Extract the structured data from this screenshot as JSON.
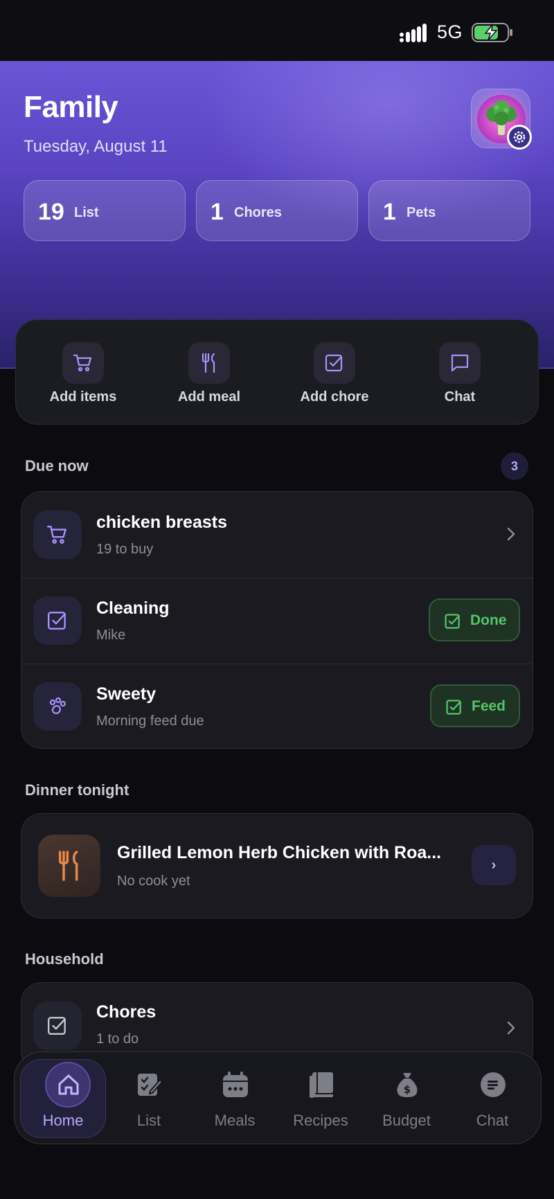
{
  "status_bar": {
    "network": "5G"
  },
  "header": {
    "title": "Family",
    "date": "Tuesday, August 11"
  },
  "stats": [
    {
      "value": "19",
      "label": "List"
    },
    {
      "value": "1",
      "label": "Chores"
    },
    {
      "value": "1",
      "label": "Pets"
    }
  ],
  "quick_actions": [
    {
      "label": "Add items",
      "icon": "cart-icon"
    },
    {
      "label": "Add meal",
      "icon": "fork-knife-icon"
    },
    {
      "label": "Add chore",
      "icon": "checkbox-icon"
    },
    {
      "label": "Chat",
      "icon": "chat-bubble-icon"
    }
  ],
  "due_now": {
    "title": "Due now",
    "count": "3",
    "items": [
      {
        "title": "chicken breasts",
        "subtitle": "19 to buy",
        "icon": "cart-icon"
      },
      {
        "title": "Cleaning",
        "subtitle": "Mike",
        "icon": "checkbox-icon",
        "action": "Done"
      },
      {
        "title": "Sweety",
        "subtitle": "Morning feed due",
        "icon": "paw-icon",
        "action": "Feed"
      }
    ]
  },
  "dinner": {
    "title": "Dinner tonight",
    "meal_title": "Grilled Lemon Herb Chicken with Roa...",
    "meal_subtitle": "No cook yet",
    "go_label": "›"
  },
  "household": {
    "title": "Household",
    "chores_title": "Chores",
    "chores_subtitle": "1 to do"
  },
  "tabs": [
    {
      "label": "Home",
      "icon": "home-icon",
      "active": true
    },
    {
      "label": "List",
      "icon": "list-icon"
    },
    {
      "label": "Meals",
      "icon": "calendar-icon"
    },
    {
      "label": "Recipes",
      "icon": "book-icon"
    },
    {
      "label": "Budget",
      "icon": "money-bag-icon"
    },
    {
      "label": "Chat",
      "icon": "chat-icon"
    }
  ],
  "colors": {
    "accent": "#7b66ff",
    "success": "#55c46a",
    "background": "#0b0b10"
  }
}
